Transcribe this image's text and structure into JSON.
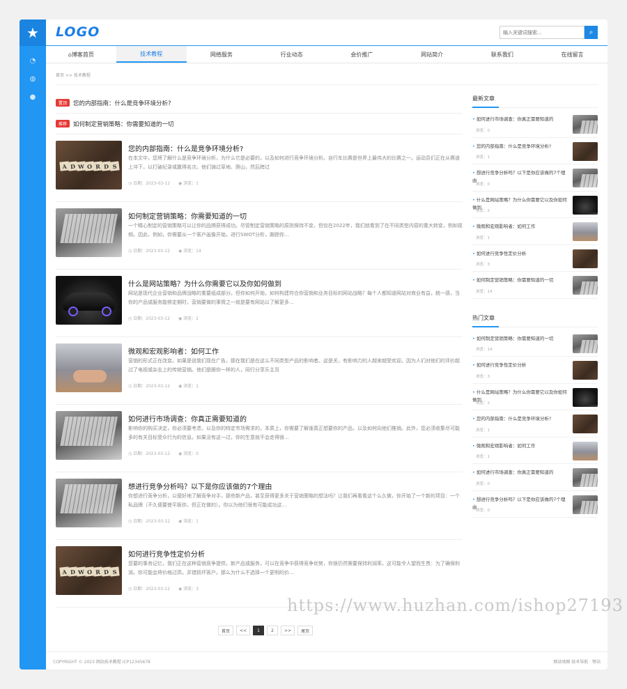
{
  "logo": "LOGO",
  "search": {
    "placeholder": "输入关键词搜索..."
  },
  "nav": [
    "博客首页",
    "技术教程",
    "网络服务",
    "行业动态",
    "会价推广",
    "网站简介",
    "联系我们",
    "在线留言"
  ],
  "breadcrumb": "首页 >> 技术教程",
  "top_items": [
    {
      "tag": "置顶",
      "title": "您的内部指南：什么是竞争环境分析?"
    },
    {
      "tag": "推荐",
      "title": "如何制定营销策略：你需要知道的一切"
    }
  ],
  "articles": [
    {
      "title": "您的内部指南：什么是竞争环境分析?",
      "desc": "在本文中，您将了解什么是竞争环境分析，为什么它是必要的，以及如何进行竞争环境分析。自行车比赛是世界上最伟大的比赛之一。运动员们正在从赛道上冲下，以打破纪录或赢得名次。他们骑过草地、爬山，然后跨过",
      "date": "日期：2023-03-12",
      "views": "浏览：1",
      "img": "wood"
    },
    {
      "title": "如何制定营销策略：你需要知道的一切",
      "desc": "一个精心制定的营销策略可以让你的品牌获得成功。尽管制定营销策略的原则保持不变，但仅在2022年，我们就看到了在不同类型内容的重大转变，例如视频。因此，例如，你需要从一个客户画像开始，进行SWOT分析，跟踪你…",
      "date": "日期：2023-03-12",
      "views": "浏览：14",
      "img": "laptop"
    },
    {
      "title": "什么是网站策略？为什么你需要它以及你如何做到",
      "desc": "网站是现代企业营销和品牌战略的重要组成部分。但你如何开始，如何构建符合你营销和业务目标的网站战略？每个人都知道网站对商业有益，统一感，当你的产品或服务能够定期时，营销要做的事情之一就是要有网站以了解更多…",
      "date": "日期：2023-03-12",
      "views": "浏览：2",
      "img": "car"
    },
    {
      "title": "微观和宏观影响者：如何工作",
      "desc": "营销的形式正在改变。如果是说我们现在广告，那在我们是在这么不同类型产品的影响者。这是关，有影响力的人越来越受欢迎。因为人们对他们的评价超过了电视或杂志上的传统营销。他们是跟你一样的人，同行分享乐主页",
      "date": "日期：2023-03-12",
      "views": "浏览：1",
      "img": "hand"
    },
    {
      "title": "如何进行市场调查：你真正需要知道的",
      "desc": "影响你的购买决定，你必须要考虑，以及你的特定市场需求的，本质上，你需要了解谁真正想要你的产品，以及如何向他们推销。此外，您必须收集尽可能多的有关目标受众行为的信息。如果没有这一过，你的生意就不会走得很…",
      "date": "日期：2023-03-12",
      "views": "浏览：0",
      "img": "laptop"
    },
    {
      "title": "想进行竞争分析吗？以下是你应该做的7个理由",
      "desc": "你想进行竞争分析，以便好地了解竞争对手，那些新产品，甚至获得更多关于营销策略的想法吗？让我们再看看这个么久做，你开始了一个新的项目：一个私品牌（不久便要使平板你，但正在做的）。你以为他们很有可能成功这…",
      "date": "日期：2023-03-12",
      "views": "浏览：1",
      "img": "laptop"
    },
    {
      "title": "如何进行竞争性定价分析",
      "desc": "您要的事务记忆，我们正在这种营销竞争提供，新产品或服务，可以在竞争中获得竞争优势，你很仍然需要保持利润率。这可能令人望而生畏：为了确保利润，你可能会将价格过高，并错损坏客户。那么为什么不选择一个更明的价…",
      "date": "日期：2023-03-12",
      "views": "浏览：3",
      "img": "wood"
    }
  ],
  "sidebar": {
    "latest_title": "最新文章",
    "latest": [
      {
        "title": "如何进行市场调查：你真正需要知道的",
        "views": "浏览：0",
        "img": "laptop"
      },
      {
        "title": "您的内部指南：什么是竞争环境分析?",
        "views": "浏览：1",
        "img": "wood"
      },
      {
        "title": "想进行竞争分析吗？以下是你应该做的7个理由",
        "views": "浏览：0",
        "img": "laptop"
      },
      {
        "title": "什么是网站策略？为什么你需要它以及你如何做到",
        "views": "浏览：2",
        "img": "car"
      },
      {
        "title": "微观和宏观影响者：如何工作",
        "views": "浏览：1",
        "img": "hand"
      },
      {
        "title": "如何进行竞争性定价分析",
        "views": "浏览：3",
        "img": "wood"
      },
      {
        "title": "如何制定营销策略：你需要知道的一切",
        "views": "浏览：14",
        "img": "laptop"
      }
    ],
    "hot_title": "热门文章",
    "hot": [
      {
        "title": "如何制定营销策略：你需要知道的一切",
        "views": "浏览：14",
        "img": "laptop"
      },
      {
        "title": "如何进行竞争性定价分析",
        "views": "浏览：3",
        "img": "wood"
      },
      {
        "title": "什么是网站策略？为什么你需要它以及你如何做到",
        "views": "浏览：2",
        "img": "car"
      },
      {
        "title": "您的内部指南：什么是竞争环境分析?",
        "views": "浏览：1",
        "img": "wood"
      },
      {
        "title": "微观和宏观影响者：如何工作",
        "views": "浏览：1",
        "img": "hand"
      },
      {
        "title": "如何进行市场调查：你真正需要知道的",
        "views": "浏览：0",
        "img": "laptop"
      },
      {
        "title": "想进行竞争分析吗？以下是你应该做的7个理由",
        "views": "浏览：0",
        "img": "laptop"
      }
    ]
  },
  "pager": [
    "首页",
    "<<",
    "1",
    "2",
    ">>",
    "尾页"
  ],
  "pager_current": "1",
  "footer": {
    "copyright": "COPYRIGHT © 2023 网站技术教程 ICP12345678",
    "right": "网站地图 技术导航 · 等站"
  },
  "watermark": "https://www.huzhan.com/ishop27193",
  "colors": {
    "accent": "#2196f3",
    "tag": "#e53935"
  }
}
